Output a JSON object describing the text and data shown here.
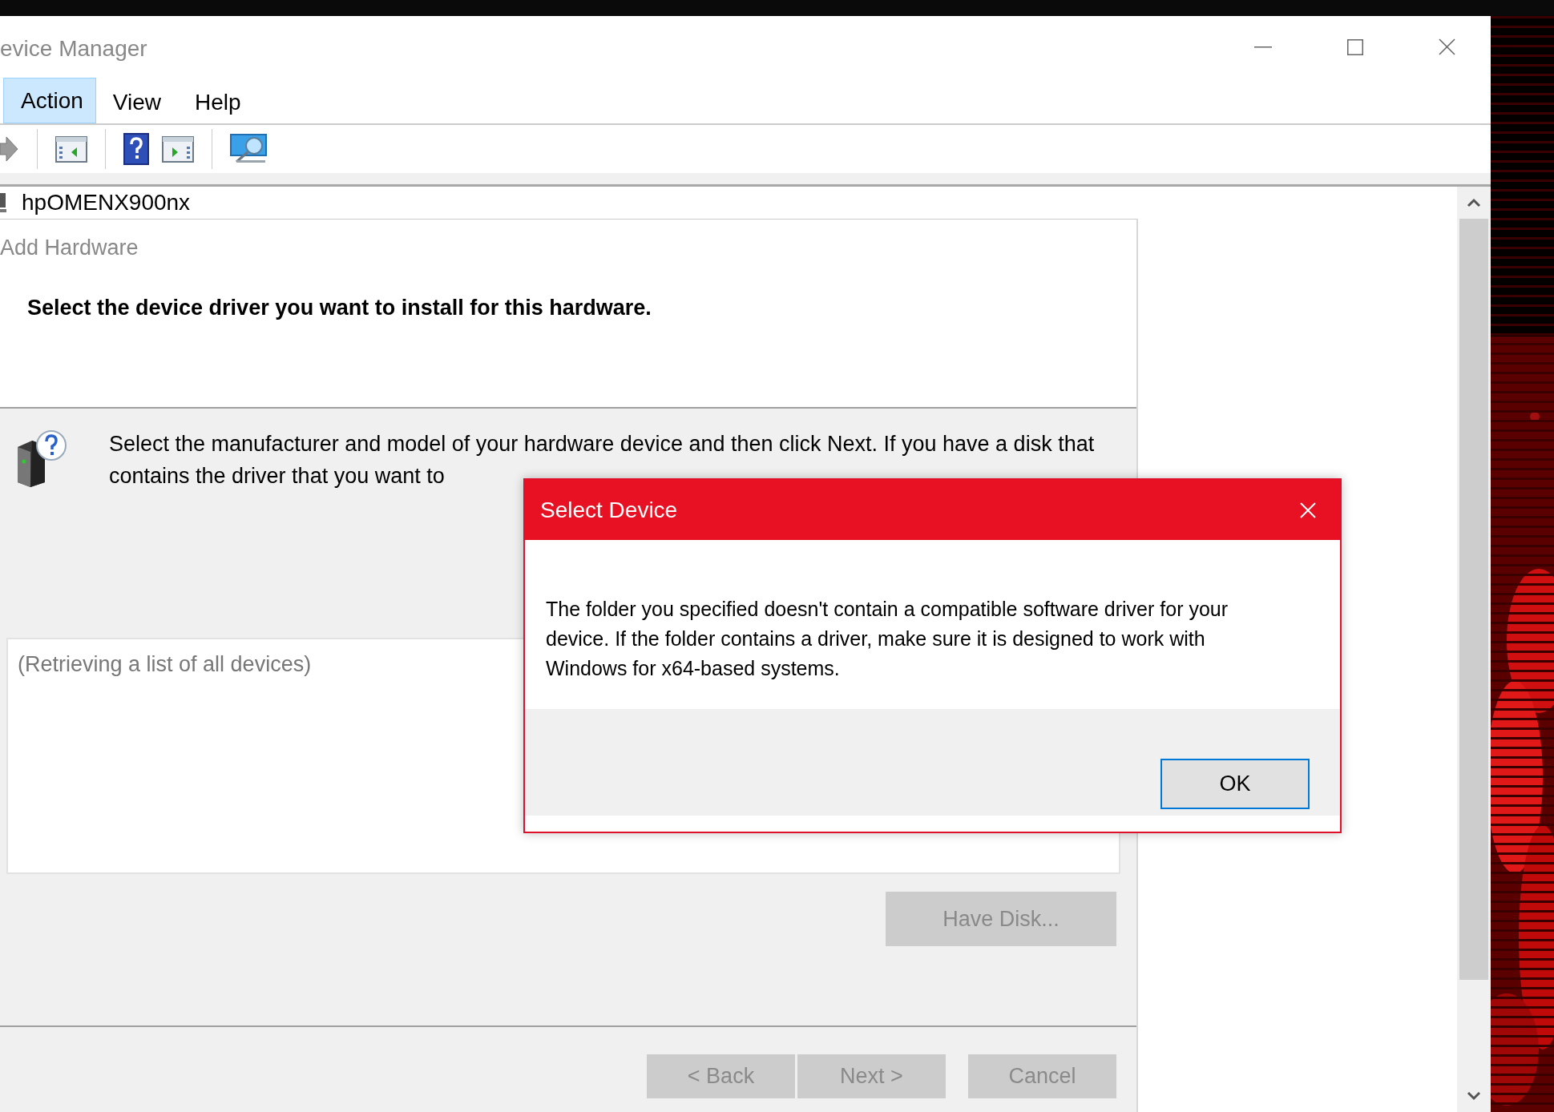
{
  "window": {
    "title": "evice Manager"
  },
  "menu": [
    {
      "label": "Action",
      "selected": true
    },
    {
      "label": "View",
      "selected": false
    },
    {
      "label": "Help",
      "selected": false
    }
  ],
  "tree": {
    "items": [
      {
        "label": "hpOMENX900nx"
      }
    ]
  },
  "wizard": {
    "title": "Add Hardware",
    "heading": "Select the device driver you want to install for this hardware.",
    "instructions": "Select the manufacturer and model of your hardware device and then click Next. If you have a disk that contains the driver that you want to",
    "device_list": {
      "status": "(Retrieving a list of all devices)"
    },
    "have_disk_button": {
      "label": "Have Disk...",
      "disabled": true
    },
    "buttons": [
      {
        "label": "< Back",
        "disabled": true
      },
      {
        "label": "Next >",
        "disabled": true
      },
      {
        "label": "Cancel",
        "disabled": true
      }
    ]
  },
  "dialog": {
    "title": "Select Device",
    "message": "The folder you specified doesn't contain a compatible software driver for your device. If the folder contains a driver, make sure it is designed to work with Windows for x64-based systems.",
    "buttons": [
      {
        "label": "OK",
        "default": true
      }
    ]
  }
}
